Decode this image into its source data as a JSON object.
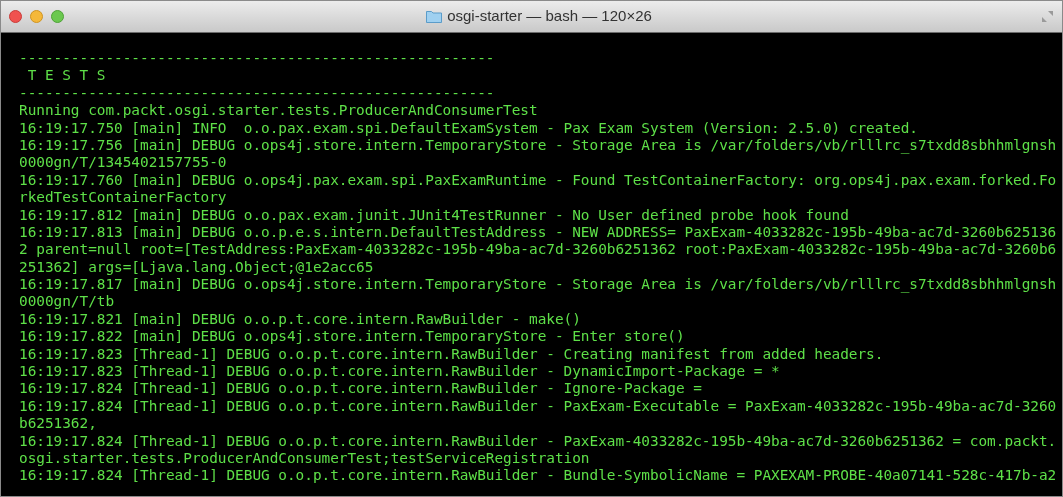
{
  "window": {
    "title": "osgi-starter — bash — 120×26"
  },
  "terminal": {
    "lines": [
      "-------------------------------------------------------",
      " T E S T S",
      "-------------------------------------------------------",
      "Running com.packt.osgi.starter.tests.ProducerAndConsumerTest",
      "16:19:17.750 [main] INFO  o.o.pax.exam.spi.DefaultExamSystem - Pax Exam System (Version: 2.5.0) created.",
      "16:19:17.756 [main] DEBUG o.ops4j.store.intern.TemporaryStore - Storage Area is /var/folders/vb/rlllrc_s7txdd8sbhhmlgnsh",
      "0000gn/T/1345402157755-0",
      "16:19:17.760 [main] DEBUG o.ops4j.pax.exam.spi.PaxExamRuntime - Found TestContainerFactory: org.ops4j.pax.exam.forked.Fo",
      "rkedTestContainerFactory",
      "16:19:17.812 [main] DEBUG o.o.pax.exam.junit.JUnit4TestRunner - No User defined probe hook found",
      "16:19:17.813 [main] DEBUG o.o.p.e.s.intern.DefaultTestAddress - NEW ADDRESS= PaxExam-4033282c-195b-49ba-ac7d-3260b625136",
      "2 parent=null root=[TestAddress:PaxExam-4033282c-195b-49ba-ac7d-3260b6251362 root:PaxExam-4033282c-195b-49ba-ac7d-3260b6",
      "251362] args=[Ljava.lang.Object;@1e2acc65",
      "16:19:17.817 [main] DEBUG o.ops4j.store.intern.TemporaryStore - Storage Area is /var/folders/vb/rlllrc_s7txdd8sbhhmlgnsh",
      "0000gn/T/tb",
      "16:19:17.821 [main] DEBUG o.o.p.t.core.intern.RawBuilder - make()",
      "16:19:17.822 [main] DEBUG o.ops4j.store.intern.TemporaryStore - Enter store()",
      "16:19:17.823 [Thread-1] DEBUG o.o.p.t.core.intern.RawBuilder - Creating manifest from added headers.",
      "16:19:17.823 [Thread-1] DEBUG o.o.p.t.core.intern.RawBuilder - DynamicImport-Package = *",
      "16:19:17.824 [Thread-1] DEBUG o.o.p.t.core.intern.RawBuilder - Ignore-Package =",
      "16:19:17.824 [Thread-1] DEBUG o.o.p.t.core.intern.RawBuilder - PaxExam-Executable = PaxExam-4033282c-195b-49ba-ac7d-3260",
      "b6251362,",
      "16:19:17.824 [Thread-1] DEBUG o.o.p.t.core.intern.RawBuilder - PaxExam-4033282c-195b-49ba-ac7d-3260b6251362 = com.packt.",
      "osgi.starter.tests.ProducerAndConsumerTest;testServiceRegistration",
      "16:19:17.824 [Thread-1] DEBUG o.o.p.t.core.intern.RawBuilder - Bundle-SymbolicName = PAXEXAM-PROBE-40a07141-528c-417b-a2"
    ]
  }
}
